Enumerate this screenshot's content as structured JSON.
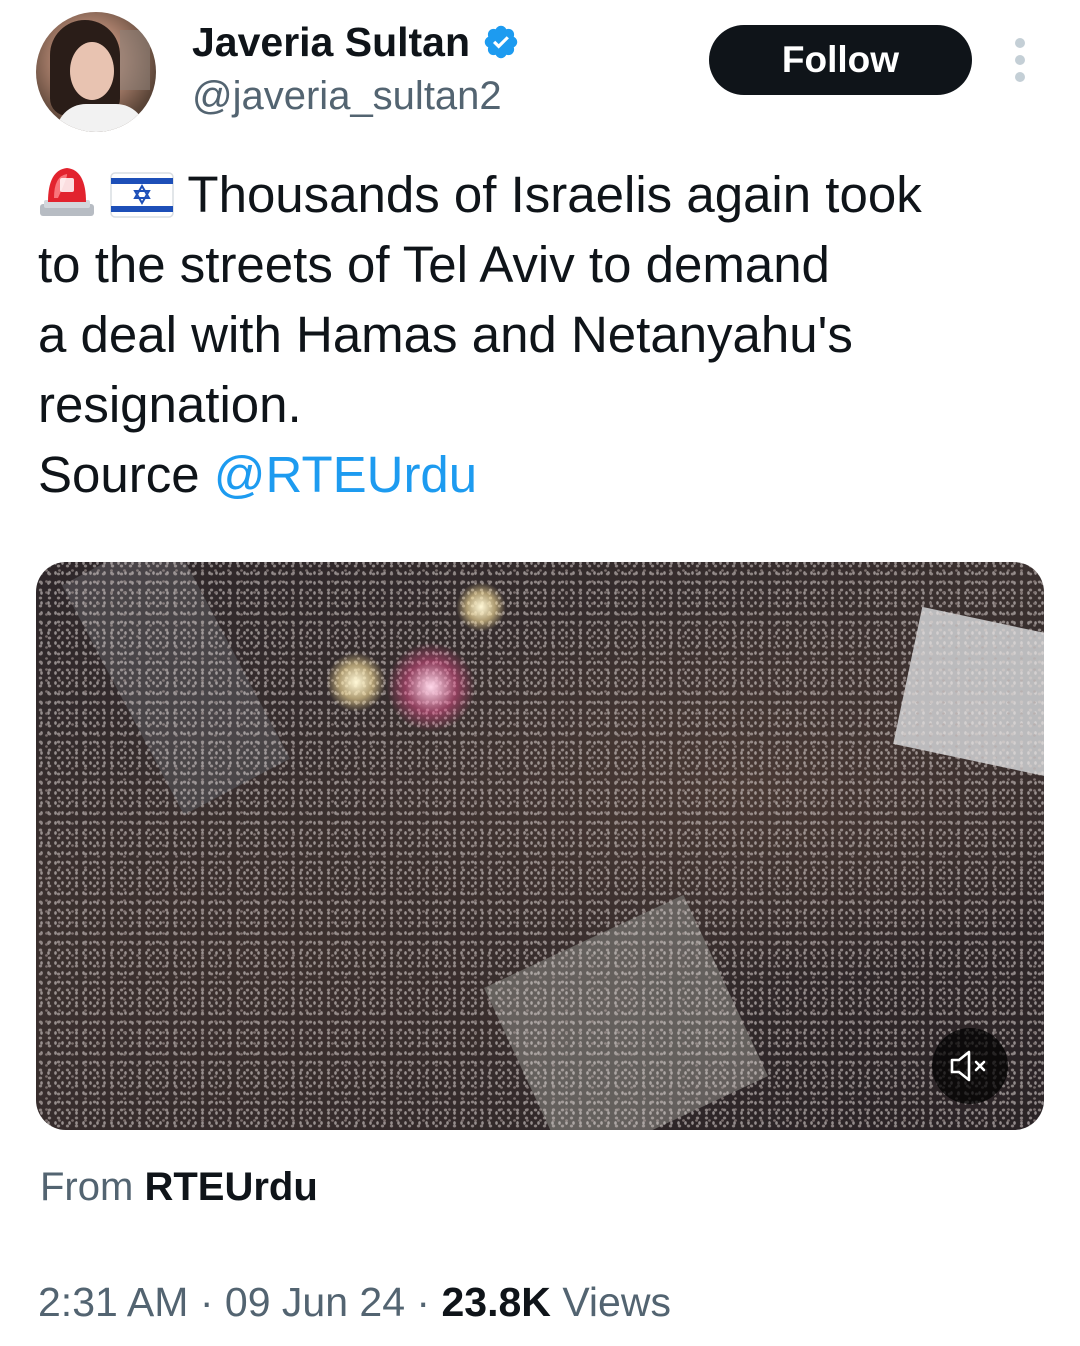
{
  "author": {
    "display_name": "Javeria Sultan",
    "handle": "@javeria_sultan2",
    "verified": true
  },
  "follow_button": {
    "label": "Follow"
  },
  "tweet": {
    "emoji": [
      "police-light-emoji",
      "israel-flag-emoji"
    ],
    "lines": [
      "Thousands of Israelis again took",
      "to the streets of Tel Aviv to demand",
      "a deal with Hamas and Netanyahu's",
      "resignation."
    ],
    "source_prefix": "Source",
    "source_mention": "@RTEUrdu"
  },
  "media": {
    "type": "video",
    "description_icon": "mute-icon"
  },
  "from": {
    "prefix": "From",
    "account": "RTEUrdu"
  },
  "meta": {
    "time": "2:31 AM",
    "separator": "·",
    "date": "09 Jun 24",
    "views_count": "23.8K",
    "views_label": "Views"
  },
  "colors": {
    "link": "#1d9bf0",
    "secondary_text": "#536471",
    "primary_text": "#0f1419",
    "verified": "#1d9bf0"
  }
}
